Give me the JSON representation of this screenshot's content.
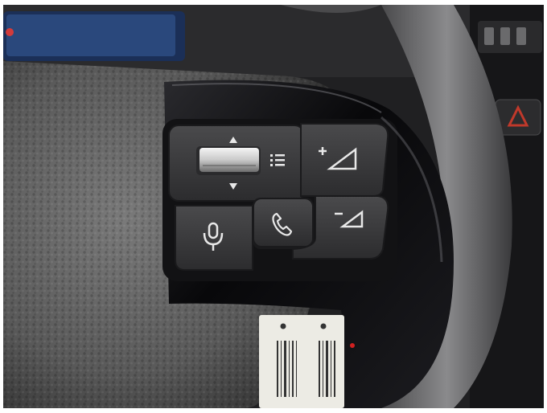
{
  "photo": {
    "subject": "steering-wheel-control-pad",
    "controls": [
      {
        "name": "scroll-wheel",
        "icon": "scroll-thumbwheel",
        "interactable": true
      },
      {
        "name": "scroll-up-arrow",
        "icon": "triangle-up-icon"
      },
      {
        "name": "scroll-down-arrow",
        "icon": "triangle-down-icon"
      },
      {
        "name": "menu-list-button",
        "icon": "list-icon"
      },
      {
        "name": "volume-up-button",
        "icon": "plus-volume-ramp-icon"
      },
      {
        "name": "volume-down-button",
        "icon": "minus-volume-ramp-icon"
      },
      {
        "name": "voice-command-button",
        "icon": "microphone-icon"
      },
      {
        "name": "phone-button",
        "icon": "phone-handset-icon"
      },
      {
        "name": "hazard-button",
        "icon": "hazard-triangle-icon"
      }
    ],
    "colors": {
      "leather": "#5f5f5f",
      "piano_black": "#0d0d0f",
      "button_face": "#3b3b3d",
      "icon": "#e8e8e8",
      "hazard": "#c0392b",
      "instrument_screen": "#2e4f86"
    }
  }
}
